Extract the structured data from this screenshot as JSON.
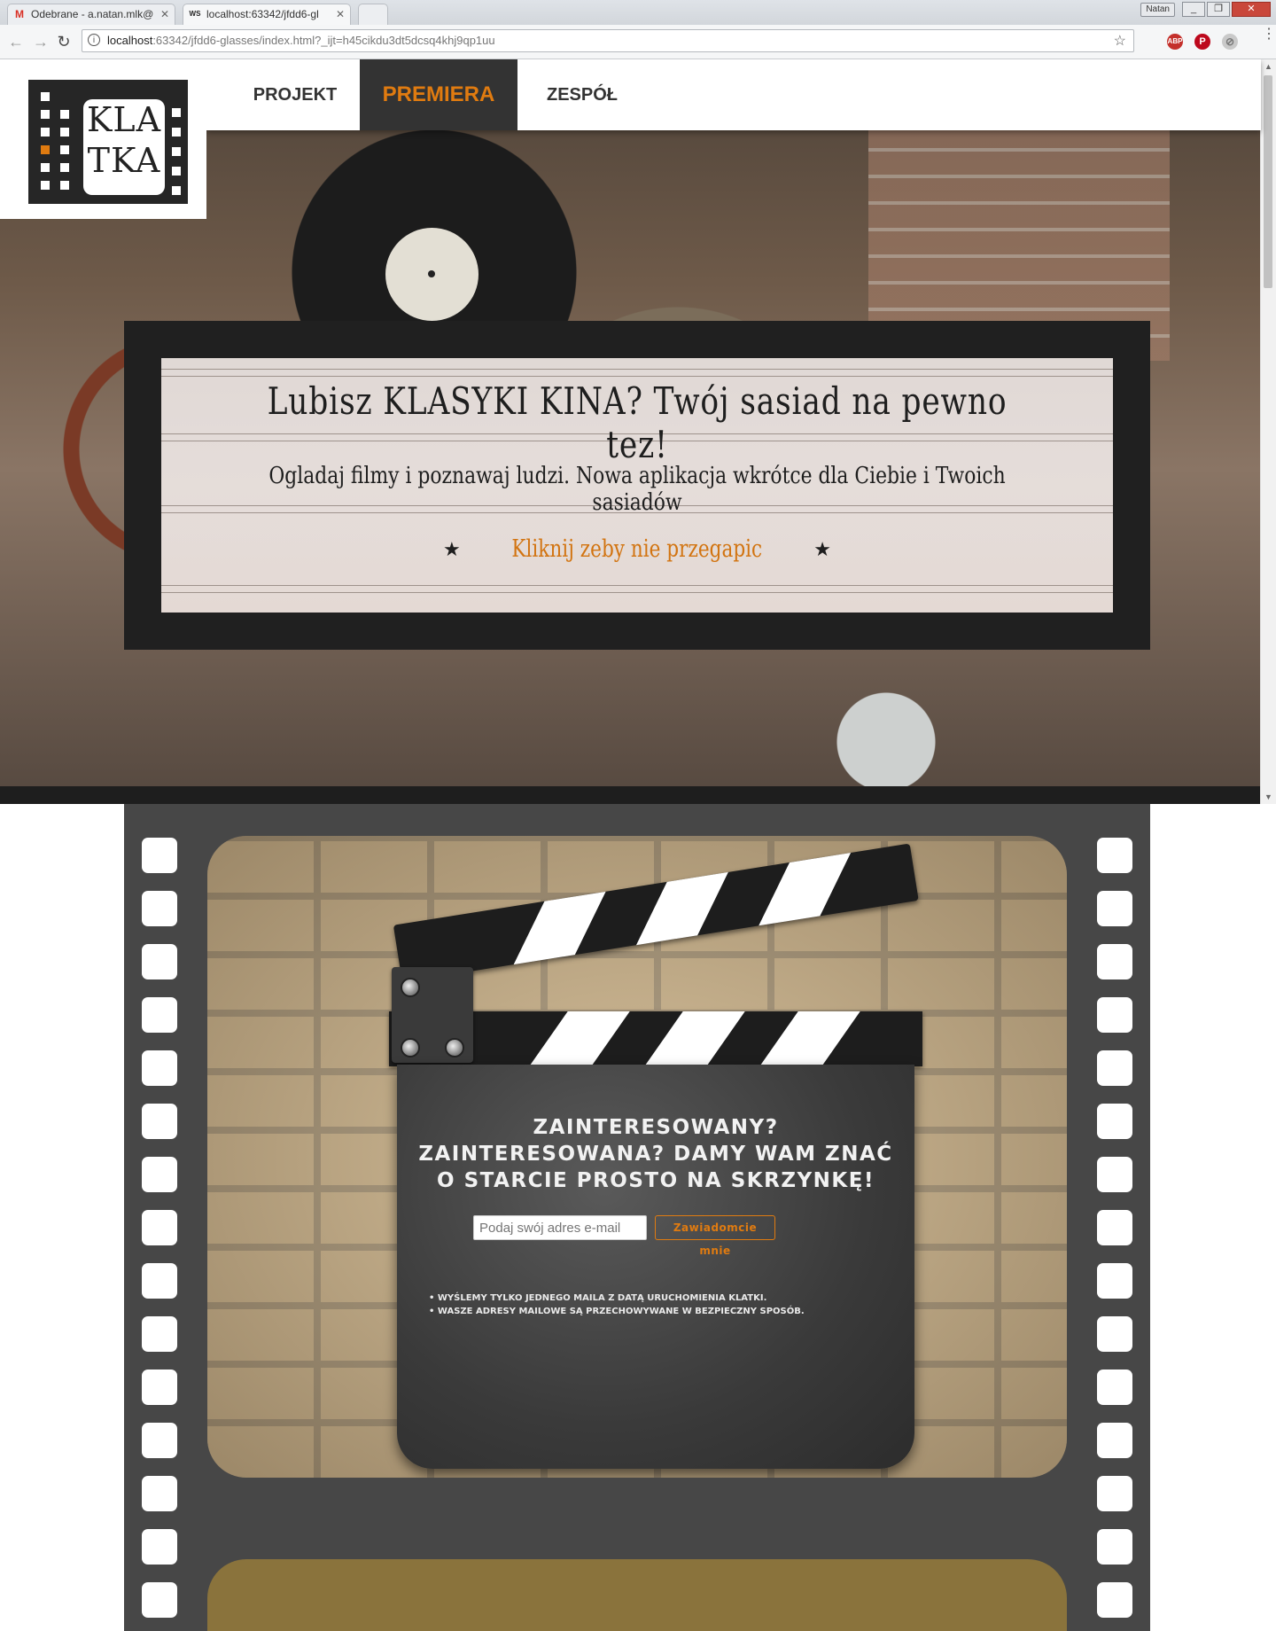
{
  "browser": {
    "tabs": [
      {
        "icon": "M",
        "title": "Odebrane - a.natan.mlk@",
        "icon_color": "#d93025"
      },
      {
        "icon": "WS",
        "title": "localhost:63342/jfdd6-gl",
        "icon_color": "#222222"
      }
    ],
    "user": "Natan",
    "window_controls": [
      "_",
      "❐",
      "✕"
    ],
    "url_host": "localhost",
    "url_rest": ":63342/jfdd6-glasses/index.html?_ijt=h45cikdu3dt5dcsq4khj9qp1uu",
    "extensions": [
      "ABP",
      "P",
      "⊘"
    ]
  },
  "logo": {
    "line1": "KLA",
    "line2": "TKA"
  },
  "nav": {
    "items": [
      {
        "label": "PROJEKT",
        "active": false
      },
      {
        "label": "PREMIERA",
        "active": true
      },
      {
        "label": "ZESPÓŁ",
        "active": false
      }
    ]
  },
  "hero": {
    "title": "Lubisz KLASYKI KINA? Twój sasiad na pewno tez!",
    "subtitle": "Ogladaj filmy i poznawaj ludzi. Nowa aplikacja wkrótce dla Ciebie i Twoich sasiadów",
    "cta": "Kliknij  zeby nie przegapic",
    "star": "★"
  },
  "signup": {
    "heading": "Zainteresowany? Zainteresowana? Damy wam znać o starcie prosto na skrzynkę!",
    "email_placeholder": "Podaj swój adres e-mail",
    "button": "Zawiadomcie mnie",
    "notes": [
      "Wyślemy tylko jednego maila z datą uruchomienia Klatki.",
      "Wasze adresy mailowe są przechowywane w bezpieczny sposób."
    ]
  },
  "colors": {
    "accent": "#e07b10",
    "dark": "#202020",
    "film": "#474747",
    "olive": "#8a733c"
  }
}
